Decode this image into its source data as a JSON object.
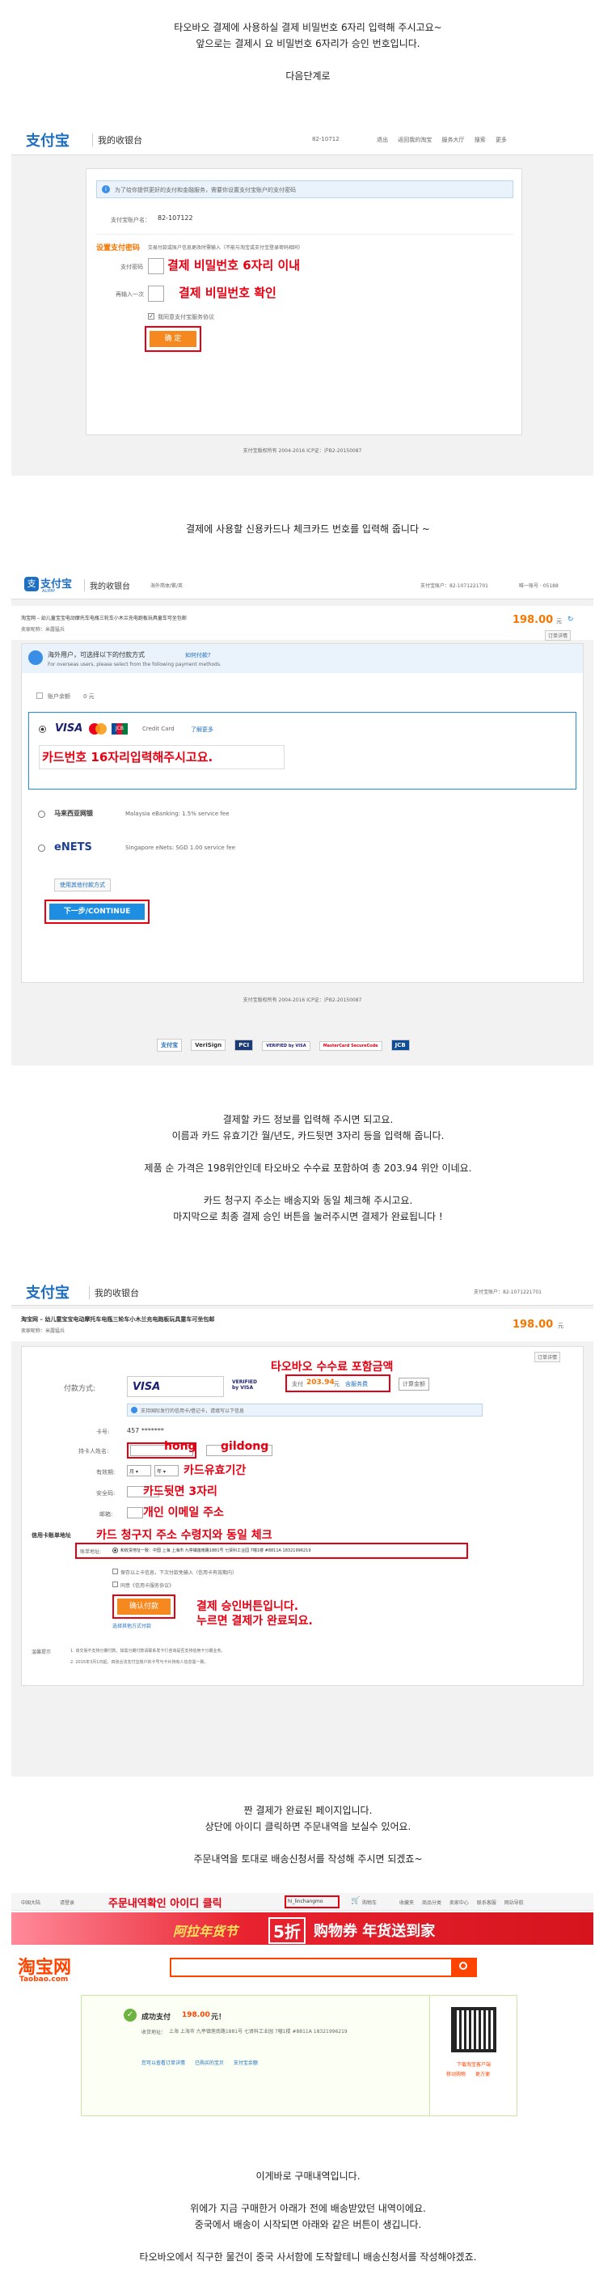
{
  "s1_caption": [
    "타오바오 결제에 사용하실 결제 비밀번호 6자리 입력해 주시고요~",
    "앞으로는 결제시 요 비밀번호 6자리가 승인 번호입니다.",
    "",
    "다음단계로"
  ],
  "s1": {
    "logo": "支付宝",
    "brand_sub": "我的收银台",
    "top_account": "82-10712",
    "top_links": [
      "退出",
      "返回我的淘宝",
      "服务大厅",
      "搜索",
      "更多"
    ],
    "notice": "为了给你提供更好的支付和金融服务，需要你设置支付宝账户的支付密码",
    "account_label": "支付宝账户名：",
    "account_value": "82-107122",
    "set_pw_title": "设置支付密码",
    "set_pw_hint": "交易付款或账户信息更改时需输入（不能与淘宝或支付宝登录密码相同）",
    "pw_label": "支付密码",
    "pw_annot": "결제 비밀번호 6자리 이내",
    "pw2_label": "再输入一次",
    "pw2_annot": "결제 비밀번호 확인",
    "agree": "我同意支付宝服务协议",
    "confirm": "确 定",
    "footer": "支付宝版权所有 2004-2016 ICP证：沪B2-20150087"
  },
  "s2_caption": [
    "결제에 사용할 신용카드나 체크카드 번호를 입력해 줍니다 ~"
  ],
  "s2": {
    "logo": "支付宝",
    "logo_en": "ALIPAY",
    "brand_sub": "我的收银台",
    "lang": "海外简体/繁/英",
    "account": "支付宝账户：82-1071221701",
    "account_extra": "唯一账号 · 05188",
    "order_title": "淘宝网 – 幼儿童宝宝电动摩托车电瓶三轮车小木兰充电跑板玩具童车可坐包邮",
    "seller": "卖家昵称：米露猛兵",
    "amount": "198.00",
    "amount_unit": "元",
    "detail_tab": "订单详情",
    "overseas_title": "海外用户，可选择以下的付款方式",
    "overseas_link": "如何付款?",
    "overseas_en": "For overseas users, please select from the following payment methods.",
    "balance_label": "账户余额",
    "balance_value": "0 元",
    "credit_card": "Credit Card",
    "learn_more": "了解更多",
    "card_annot": "카드번호 16자리입력해주시고요.",
    "malaysia_name": "马来西亚网银",
    "malaysia": "Malaysia eBanking: 1.5% service fee",
    "enets": "eNETS",
    "singapore": "Singapore eNets: SGD 1.00 service fee",
    "other_method": "使用其他付款方式",
    "next": "下一步/CONTINUE",
    "footer": "支付宝版权所有 2004-2016 ICP证：沪B2-20150087",
    "badges": [
      "支付宝",
      "VeriSign",
      "PCI",
      "VERIFIED by VISA",
      "MasterCard SecureCode",
      "JCB"
    ]
  },
  "s3_caption": [
    "결제할 카드 정보를 입력해 주시면 되고요.",
    "이름과 카드 유효기간 월/년도, 카드뒷면 3자리 등을 입력해 줍니다.",
    "",
    "제품 순 가격은 198위안인데 타오바오 수수료 포함하여 총 203.94 위안 이네요.",
    "",
    "카드 청구지 주소는 배송지와 동일 체크해 주시고요.",
    "마지막으로 최종 결제 승인 버튼을 눌러주시면 결제가 완료됩니다 !"
  ],
  "s3": {
    "logo": "支付宝",
    "brand_sub": "我的收银台",
    "account": "支付宝账户：82-1071221701",
    "order_title": "淘宝网 – 幼儿童宝宝电动摩托车电瓶三轮车小木兰充电跑板玩具童车可坐包邮",
    "seller": "卖家昵称：米露猛兵",
    "amount": "198.00",
    "amount_unit": "元",
    "detail_tab": "订单详情",
    "pay_method_label": "付款方式:",
    "visa": "VISA",
    "fee_annot": "타오바오 수수료 포함금액",
    "pay_total_prefix": "支付",
    "pay_total": "203.94",
    "pay_total_suffix": "元",
    "fee_link": "含服务费",
    "calc": "计算金额",
    "info_notice": "支持国际发行的信用卡/借记卡，请填写以下信息",
    "card_no_label": "卡号:",
    "card_no_value": "457 *******",
    "holder_label": "持卡人姓名:",
    "first_name": "hong",
    "last_name": "gildong",
    "expiry_label": "有效期:",
    "month": "月",
    "year": "年",
    "expiry_annot": "카드유효기간",
    "cvv_label": "安全码:",
    "cvv_annot": "카드뒷면 3자리",
    "email_label": "邮箱:",
    "email_annot": "개인 이메일 주소",
    "bill_title": "信用卡账单地址",
    "bill_annot": "카드 청구지 주소 수령지와 동일 체크",
    "bill_label": "账单地址:",
    "bill_value": "和收货地址一致：中国 上海 上海市 九亭镇莲南路1881号 七贤科工业园 7幢1楼 #8811A 18321996219",
    "save_info": "保存以上卡信息，下次付款免输入（信用卡有效期内）",
    "agree": "同意《信用卡服务协议》",
    "submit": "确认付款",
    "submit_annot_1": "결제 승인버튼입니다.",
    "submit_annot_2": "누르면 결제가 완료되요.",
    "back_link": "选择其他方式付款",
    "fine_label": "温馨提示",
    "fine_1": "1. 该交易不支持分期付款，如需分期付款请联系发卡行咨询是否支持信用卡分期业务。",
    "fine_2": "2. 2015年3月1日起，四张合法支付宝账户的卡号与卡片持有人信息需一致。"
  },
  "s4_caption": [
    "짠 결제가 완료된 페이지입니다.",
    "상단에 아이디 클릭하면 주문내역을 보실수 있어요.",
    "",
    "주문내역을 토대로 배송신청서를 작성해 주시면 되겠죠~"
  ],
  "s4": {
    "top_left": [
      "中国大陆",
      "请登录"
    ],
    "id_annot": "주문내역확인 아이디 클릭",
    "user_id": "hi_linchangmo",
    "cart": "购物车",
    "top_right": [
      "收藏夹",
      "商品分类",
      "卖家中心",
      "联系客服",
      "网站导航"
    ],
    "banner_left": "阿拉年货节",
    "banner_mid": "5折",
    "banner_right": "购物券 年货送到家",
    "logo": "淘宝网",
    "logo_en": "Taobao.com",
    "success_prefix": "成功支付",
    "success_amount": "198.00",
    "success_suffix": "元！",
    "addr_label": "收货地址：",
    "addr_value": "上海 上海市 九亭镇莲南路1881号 七贤科工业园 7幢1楼 #8811A 18321996219",
    "links": [
      "您可以查看订单详情",
      "已购买的宝贝",
      "支付宝余额"
    ],
    "qr_text_1": "下载淘宝客户端",
    "qr_text_2": "移动购物",
    "qr_text_3": "更方便"
  },
  "s5_caption": [
    "이게바로 구매내역입니다.",
    "",
    "위에가 지금 구매한거 아래가 전에 배송받았던 내역이에요.",
    "중국에서 배송이 시작되면 아래와 같은 버튼이 생깁니다.",
    "",
    "타오바오에서 직구한 물건이 중국 사서함에 도착할테니 배송신청서를 작성해야겠죠."
  ]
}
